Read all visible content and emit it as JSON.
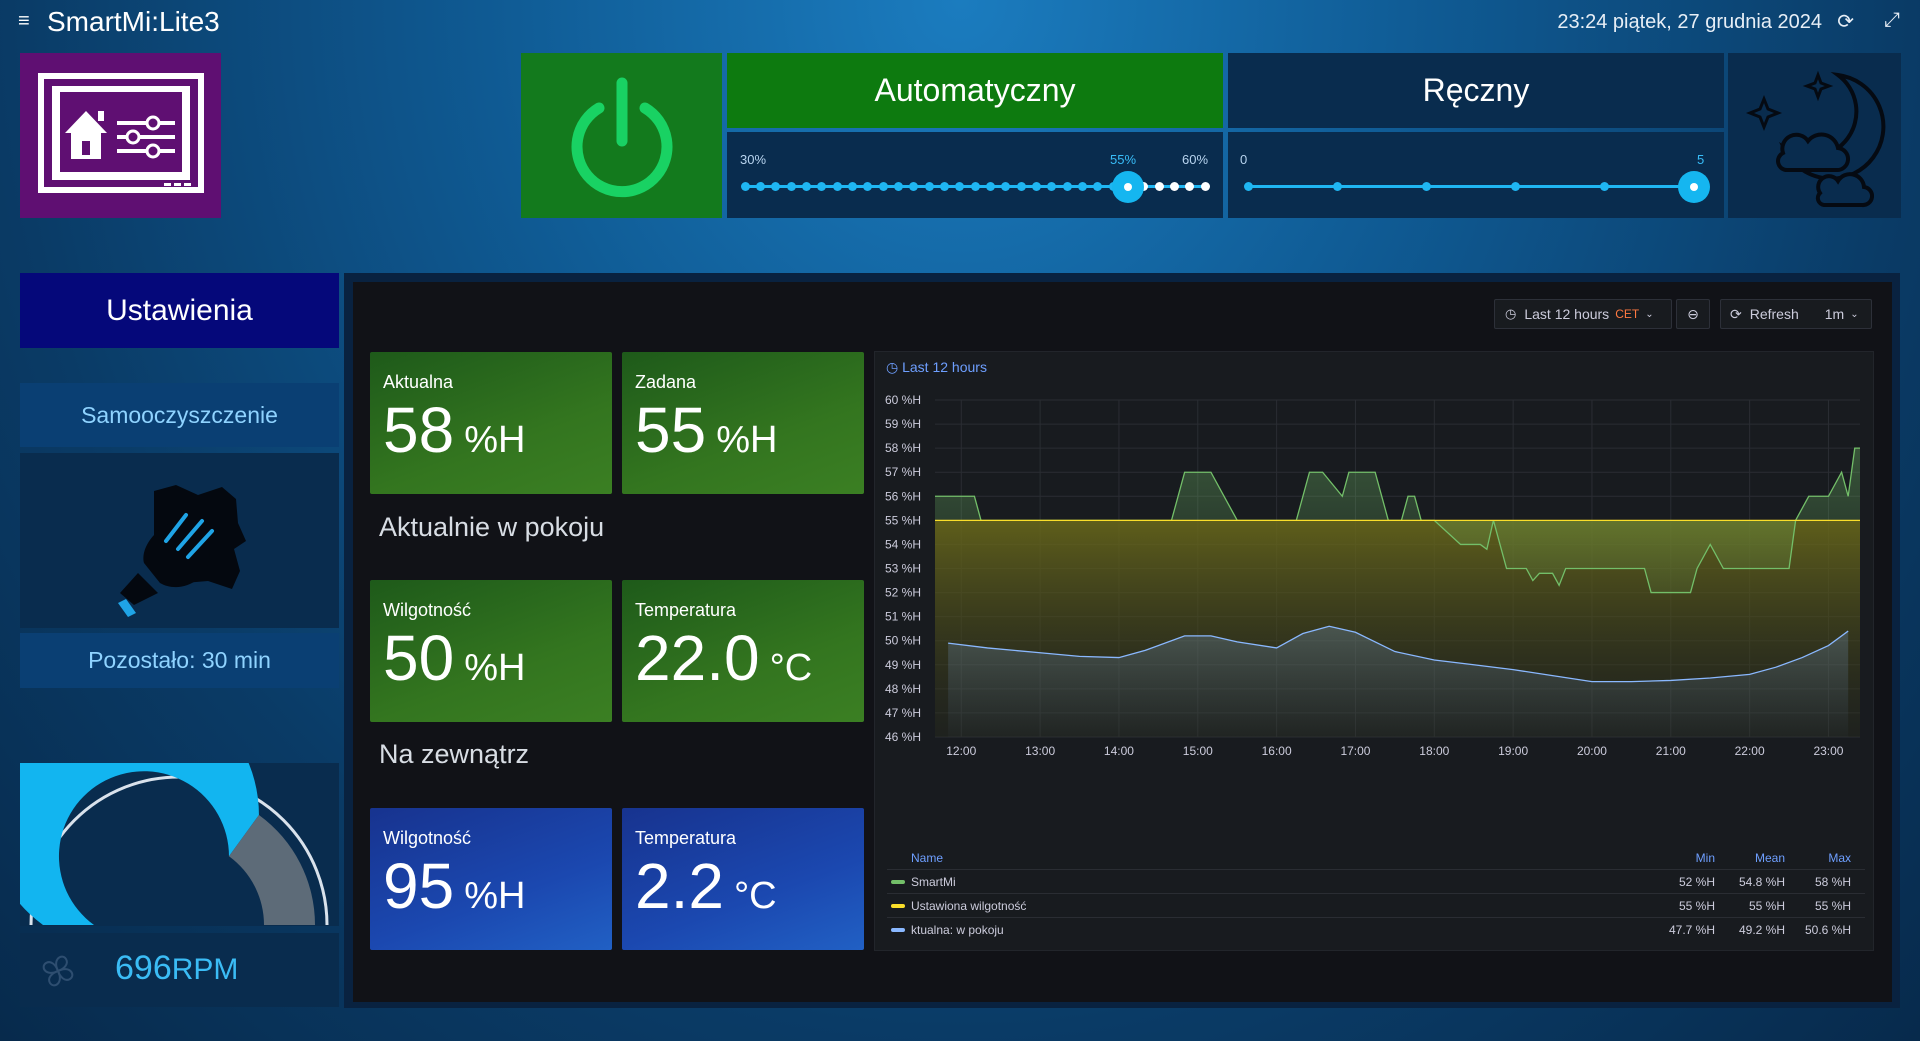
{
  "header": {
    "title": "SmartMi:Lite3",
    "datetime": "23:24 piątek, 27 grudnia 2024"
  },
  "modes": {
    "auto_label": "Automatyczny",
    "manual_label": "Ręczny"
  },
  "auto_slider": {
    "min_label": "30%",
    "max_label": "60%",
    "value_label": "55%",
    "min": 30,
    "max": 60,
    "value": 55
  },
  "manual_slider": {
    "min_label": "0",
    "max_label": "5",
    "min": 0,
    "max": 5,
    "value": 5
  },
  "left": {
    "settings_label": "Ustawienia",
    "selfclean_label": "Samooczyszczenie",
    "remaining_label": "Pozostało: 30 min",
    "gauge_fraction": 0.7,
    "rpm_value": "696",
    "rpm_unit": "RPM"
  },
  "stats": {
    "current": {
      "label": "Aktualna",
      "value": "58",
      "unit": "%H"
    },
    "target": {
      "label": "Zadana",
      "value": "55",
      "unit": "%H"
    },
    "room_title": "Aktualnie w pokoju",
    "room_humidity": {
      "label": "Wilgotność",
      "value": "50",
      "unit": "%H"
    },
    "room_temp": {
      "label": "Temperatura",
      "value": "22.0",
      "unit": "°C"
    },
    "outside_title": "Na zewnątrz",
    "outside_humidity": {
      "label": "Wilgotność",
      "value": "95",
      "unit": "%H"
    },
    "outside_temp": {
      "label": "Temperatura",
      "value": "2.2",
      "unit": "°C"
    }
  },
  "time_controls": {
    "range_label": "Last 12 hours",
    "tz_label": "CET",
    "refresh_label": "Refresh",
    "interval_label": "1m"
  },
  "colors": {
    "smartmi": "#73bf69",
    "target": "#fade2a",
    "room": "#8ab8ff"
  },
  "graph": {
    "title": "Last 12 hours",
    "legend_header": {
      "name": "Name",
      "min": "Min",
      "mean": "Mean",
      "max": "Max"
    },
    "legend": [
      {
        "name": "SmartMi",
        "min": "52 %H",
        "mean": "54.8 %H",
        "max": "58 %H"
      },
      {
        "name": "Ustawiona wilgotność",
        "min": "55 %H",
        "mean": "55 %H",
        "max": "55 %H"
      },
      {
        "name": "ktualna: w pokoju",
        "min": "47.7 %H",
        "mean": "49.2 %H",
        "max": "50.6 %H"
      }
    ]
  },
  "chart_data": {
    "type": "line",
    "title": "Last 12 hours",
    "x_tick_labels": [
      "12:00",
      "13:00",
      "14:00",
      "15:00",
      "16:00",
      "17:00",
      "18:00",
      "19:00",
      "20:00",
      "21:00",
      "22:00",
      "23:00"
    ],
    "y_tick_labels": [
      "60 %H",
      "59 %H",
      "58 %H",
      "57 %H",
      "56 %H",
      "55 %H",
      "54 %H",
      "53 %H",
      "52 %H",
      "51 %H",
      "50 %H",
      "49 %H",
      "48 %H",
      "47 %H",
      "46 %H"
    ],
    "ylim": [
      46,
      60
    ],
    "xlim": [
      "11:40",
      "23:24"
    ],
    "grid": true,
    "legend_position": "bottom",
    "series": [
      {
        "name": "SmartMi",
        "x": [
          "11:40",
          "12:10",
          "12:15",
          "14:40",
          "14:45",
          "14:50",
          "15:10",
          "15:20",
          "15:30",
          "16:15",
          "16:25",
          "16:35",
          "16:50",
          "16:55",
          "17:15",
          "17:20",
          "17:25",
          "17:35",
          "17:40",
          "17:45",
          "17:50",
          "18:00",
          "18:20",
          "18:25",
          "18:35",
          "18:40",
          "18:45",
          "18:50",
          "18:55",
          "19:00",
          "19:10",
          "19:15",
          "19:20",
          "19:30",
          "19:35",
          "19:40",
          "19:50",
          "19:55",
          "20:00",
          "20:05",
          "20:40",
          "20:45",
          "21:00",
          "21:15",
          "21:20",
          "21:30",
          "21:35",
          "21:40",
          "21:55",
          "22:00",
          "22:05",
          "22:15",
          "22:30",
          "22:35",
          "22:45",
          "23:00",
          "23:10",
          "23:15",
          "23:20",
          "23:24"
        ],
        "values": [
          56,
          56,
          55,
          55,
          56,
          57,
          57,
          56,
          55,
          55,
          57,
          57,
          56,
          57,
          57,
          56,
          55,
          55,
          56,
          56,
          55,
          55,
          54,
          54,
          54,
          53.8,
          55,
          54,
          53,
          53,
          53,
          52.5,
          52.8,
          52.8,
          52.3,
          53,
          53,
          53,
          53,
          53,
          53,
          52,
          52,
          52,
          53,
          54,
          53.5,
          53,
          53,
          53,
          53,
          53,
          53,
          55,
          56,
          56,
          57,
          56,
          58,
          58
        ]
      },
      {
        "name": "Ustawiona wilgotność",
        "x": [
          "11:40",
          "23:24"
        ],
        "values": [
          55,
          55
        ]
      },
      {
        "name": "ktualna: w pokoju",
        "x": [
          "11:50",
          "12:20",
          "13:00",
          "13:30",
          "14:00",
          "14:20",
          "14:50",
          "15:10",
          "15:30",
          "16:00",
          "16:20",
          "16:40",
          "17:00",
          "17:30",
          "18:00",
          "18:30",
          "19:00",
          "19:30",
          "20:00",
          "20:30",
          "21:00",
          "21:30",
          "22:00",
          "22:20",
          "22:40",
          "23:00",
          "23:15"
        ],
        "values": [
          49.9,
          49.7,
          49.5,
          49.35,
          49.3,
          49.6,
          50.2,
          50.2,
          49.95,
          49.7,
          50.3,
          50.6,
          50.35,
          49.55,
          49.2,
          49.0,
          48.8,
          48.55,
          48.3,
          48.3,
          48.35,
          48.45,
          48.6,
          48.9,
          49.3,
          49.8,
          50.4
        ]
      }
    ]
  }
}
